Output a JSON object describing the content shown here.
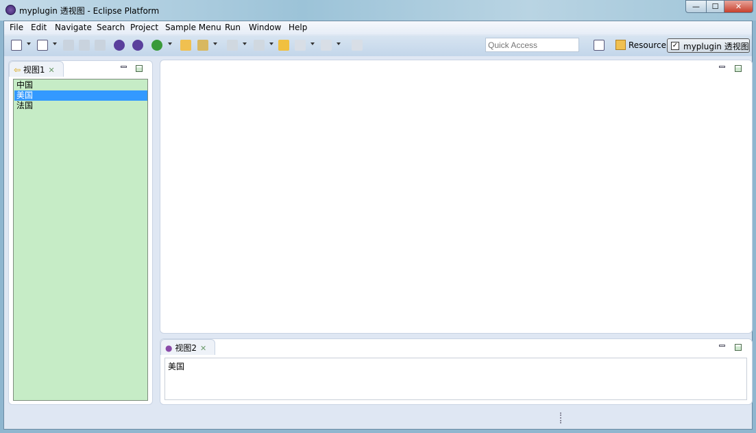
{
  "window": {
    "title": "myplugin 透视图 - Eclipse Platform",
    "minimize": "—",
    "maximize": "☐",
    "close": "✕"
  },
  "menu": [
    "File",
    "Edit",
    "Navigate",
    "Search",
    "Project",
    "Sample Menu",
    "Run",
    "Window",
    "Help"
  ],
  "toolbar": {
    "quick_access_placeholder": "Quick Access"
  },
  "perspectives": {
    "resource": "Resource",
    "active": "myplugin 透视图"
  },
  "view1": {
    "tab": "视图1",
    "items": [
      "中国",
      "美国",
      "法国"
    ],
    "selected_index": 1
  },
  "view2": {
    "tab": "视图2",
    "content": "美国"
  },
  "colors": {
    "list_bg": "#c6ecc6",
    "selection": "#3399ff"
  }
}
